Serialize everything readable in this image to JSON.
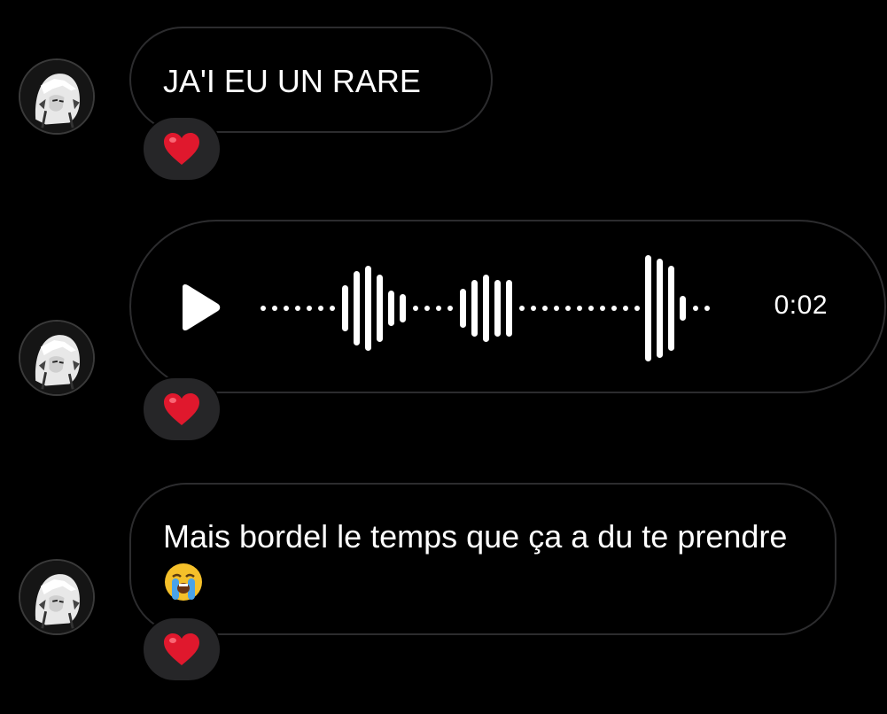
{
  "messages": [
    {
      "type": "text",
      "text": "JA'I EU UN RARE",
      "reaction": "heart-emoji"
    },
    {
      "type": "voice",
      "duration": "0:02",
      "reaction": "heart-emoji"
    },
    {
      "type": "text",
      "text": "Mais bordel le temps que ça a du te prendre",
      "trailing_emoji": "loudly-crying-face-emoji",
      "reaction": "heart-emoji"
    }
  ],
  "colors": {
    "background": "#000000",
    "bubble_border": "#2c2c2e",
    "reaction_bg": "#262628",
    "text": "#ffffff",
    "heart": "#e0182d"
  }
}
